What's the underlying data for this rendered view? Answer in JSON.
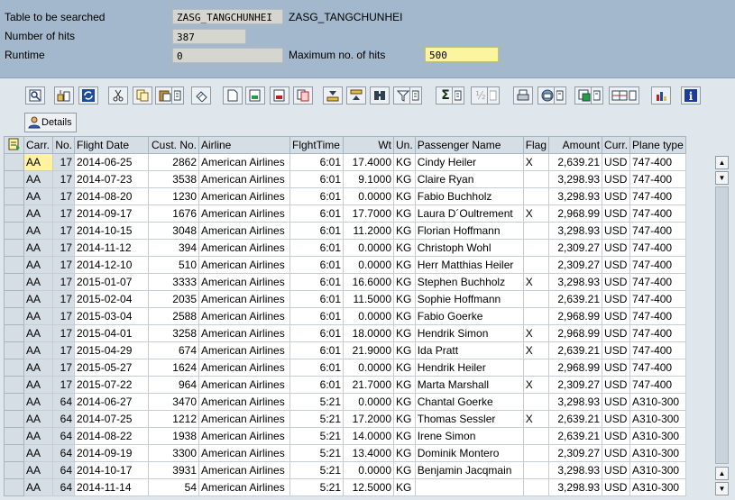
{
  "header": {
    "table_label": "Table to be searched",
    "table_value": "ZASG_TANGCHUNHEI",
    "table_desc": "ZASG_TANGCHUNHEI",
    "hits_label": "Number of hits",
    "hits_value": "387",
    "runtime_label": "Runtime",
    "runtime_value": "0",
    "max_label": "Maximum no. of hits",
    "max_value": "500"
  },
  "toolbar": {
    "icons": [
      "detail-view-icon",
      "sort-options-icon",
      "refresh-icon",
      "cut-icon",
      "copy-icon",
      "paste-icon",
      "paste-menu-icon",
      "undo-icon",
      "new-row-icon",
      "insert-row-icon",
      "delete-row-icon",
      "copy-row-icon",
      "sort-ascending-icon",
      "sort-descending-icon",
      "find-icon",
      "filter-icon",
      "filter-menu-icon",
      "sum-icon",
      "sum-menu-icon",
      "subtotal-icon",
      "subtotal-menu-icon",
      "print-icon",
      "export-icon",
      "export-menu-icon",
      "layout-icon",
      "layout-menu-icon",
      "graphic-icon",
      "information-icon"
    ],
    "details_label": "Details"
  },
  "grid": {
    "columns": [
      "Carr.",
      "No.",
      "Flight Date",
      "Cust. No.",
      "Airline",
      "FlghtTime",
      "Wt",
      "Un.",
      "Passenger Name",
      "Flag",
      "Amount",
      "Curr.",
      "Plane type"
    ],
    "rows": [
      [
        "AA",
        "17",
        "2014-06-25",
        "2862",
        "American Airlines",
        "6:01",
        "17.4000",
        "KG",
        "Cindy Heiler",
        "X",
        "2,639.21",
        "USD",
        "747-400"
      ],
      [
        "AA",
        "17",
        "2014-07-23",
        "3538",
        "American Airlines",
        "6:01",
        "9.1000",
        "KG",
        "Claire Ryan",
        "",
        "3,298.93",
        "USD",
        "747-400"
      ],
      [
        "AA",
        "17",
        "2014-08-20",
        "1230",
        "American Airlines",
        "6:01",
        "0.0000",
        "KG",
        "Fabio Buchholz",
        "",
        "3,298.93",
        "USD",
        "747-400"
      ],
      [
        "AA",
        "17",
        "2014-09-17",
        "1676",
        "American Airlines",
        "6:01",
        "17.7000",
        "KG",
        "Laura D´Oultrement",
        "X",
        "2,968.99",
        "USD",
        "747-400"
      ],
      [
        "AA",
        "17",
        "2014-10-15",
        "3048",
        "American Airlines",
        "6:01",
        "11.2000",
        "KG",
        "Florian Hoffmann",
        "",
        "3,298.93",
        "USD",
        "747-400"
      ],
      [
        "AA",
        "17",
        "2014-11-12",
        "394",
        "American Airlines",
        "6:01",
        "0.0000",
        "KG",
        "Christoph Wohl",
        "",
        "2,309.27",
        "USD",
        "747-400"
      ],
      [
        "AA",
        "17",
        "2014-12-10",
        "510",
        "American Airlines",
        "6:01",
        "0.0000",
        "KG",
        "Herr Matthias Heiler",
        "",
        "2,309.27",
        "USD",
        "747-400"
      ],
      [
        "AA",
        "17",
        "2015-01-07",
        "3333",
        "American Airlines",
        "6:01",
        "16.6000",
        "KG",
        "Stephen Buchholz",
        "X",
        "3,298.93",
        "USD",
        "747-400"
      ],
      [
        "AA",
        "17",
        "2015-02-04",
        "2035",
        "American Airlines",
        "6:01",
        "11.5000",
        "KG",
        "Sophie Hoffmann",
        "",
        "2,639.21",
        "USD",
        "747-400"
      ],
      [
        "AA",
        "17",
        "2015-03-04",
        "2588",
        "American Airlines",
        "6:01",
        "0.0000",
        "KG",
        "Fabio Goerke",
        "",
        "2,968.99",
        "USD",
        "747-400"
      ],
      [
        "AA",
        "17",
        "2015-04-01",
        "3258",
        "American Airlines",
        "6:01",
        "18.0000",
        "KG",
        "Hendrik Simon",
        "X",
        "2,968.99",
        "USD",
        "747-400"
      ],
      [
        "AA",
        "17",
        "2015-04-29",
        "674",
        "American Airlines",
        "6:01",
        "21.9000",
        "KG",
        "Ida Pratt",
        "X",
        "2,639.21",
        "USD",
        "747-400"
      ],
      [
        "AA",
        "17",
        "2015-05-27",
        "1624",
        "American Airlines",
        "6:01",
        "0.0000",
        "KG",
        "Hendrik Heiler",
        "",
        "2,968.99",
        "USD",
        "747-400"
      ],
      [
        "AA",
        "17",
        "2015-07-22",
        "964",
        "American Airlines",
        "6:01",
        "21.7000",
        "KG",
        "Marta Marshall",
        "X",
        "2,309.27",
        "USD",
        "747-400"
      ],
      [
        "AA",
        "64",
        "2014-06-27",
        "3470",
        "American Airlines",
        "5:21",
        "0.0000",
        "KG",
        "Chantal Goerke",
        "",
        "3,298.93",
        "USD",
        "A310-300"
      ],
      [
        "AA",
        "64",
        "2014-07-25",
        "1212",
        "American Airlines",
        "5:21",
        "17.2000",
        "KG",
        "Thomas Sessler",
        "X",
        "2,639.21",
        "USD",
        "A310-300"
      ],
      [
        "AA",
        "64",
        "2014-08-22",
        "1938",
        "American Airlines",
        "5:21",
        "14.0000",
        "KG",
        "Irene Simon",
        "",
        "2,639.21",
        "USD",
        "A310-300"
      ],
      [
        "AA",
        "64",
        "2014-09-19",
        "3300",
        "American Airlines",
        "5:21",
        "13.4000",
        "KG",
        "Dominik Montero",
        "",
        "2,309.27",
        "USD",
        "A310-300"
      ],
      [
        "AA",
        "64",
        "2014-10-17",
        "3931",
        "American Airlines",
        "5:21",
        "0.0000",
        "KG",
        "Benjamin Jacqmain",
        "",
        "3,298.93",
        "USD",
        "A310-300"
      ],
      [
        "AA",
        "64",
        "2014-11-14",
        "54",
        "American Airlines",
        "5:21",
        "12.5000",
        "KG",
        "",
        "",
        "3,298.93",
        "USD",
        "A310-300"
      ]
    ]
  },
  "colors": {
    "header_bg": "#a3b8cc",
    "grid_header": "#d5dde5",
    "highlight": "#fff3a0",
    "max_field": "#fdf4a0"
  }
}
